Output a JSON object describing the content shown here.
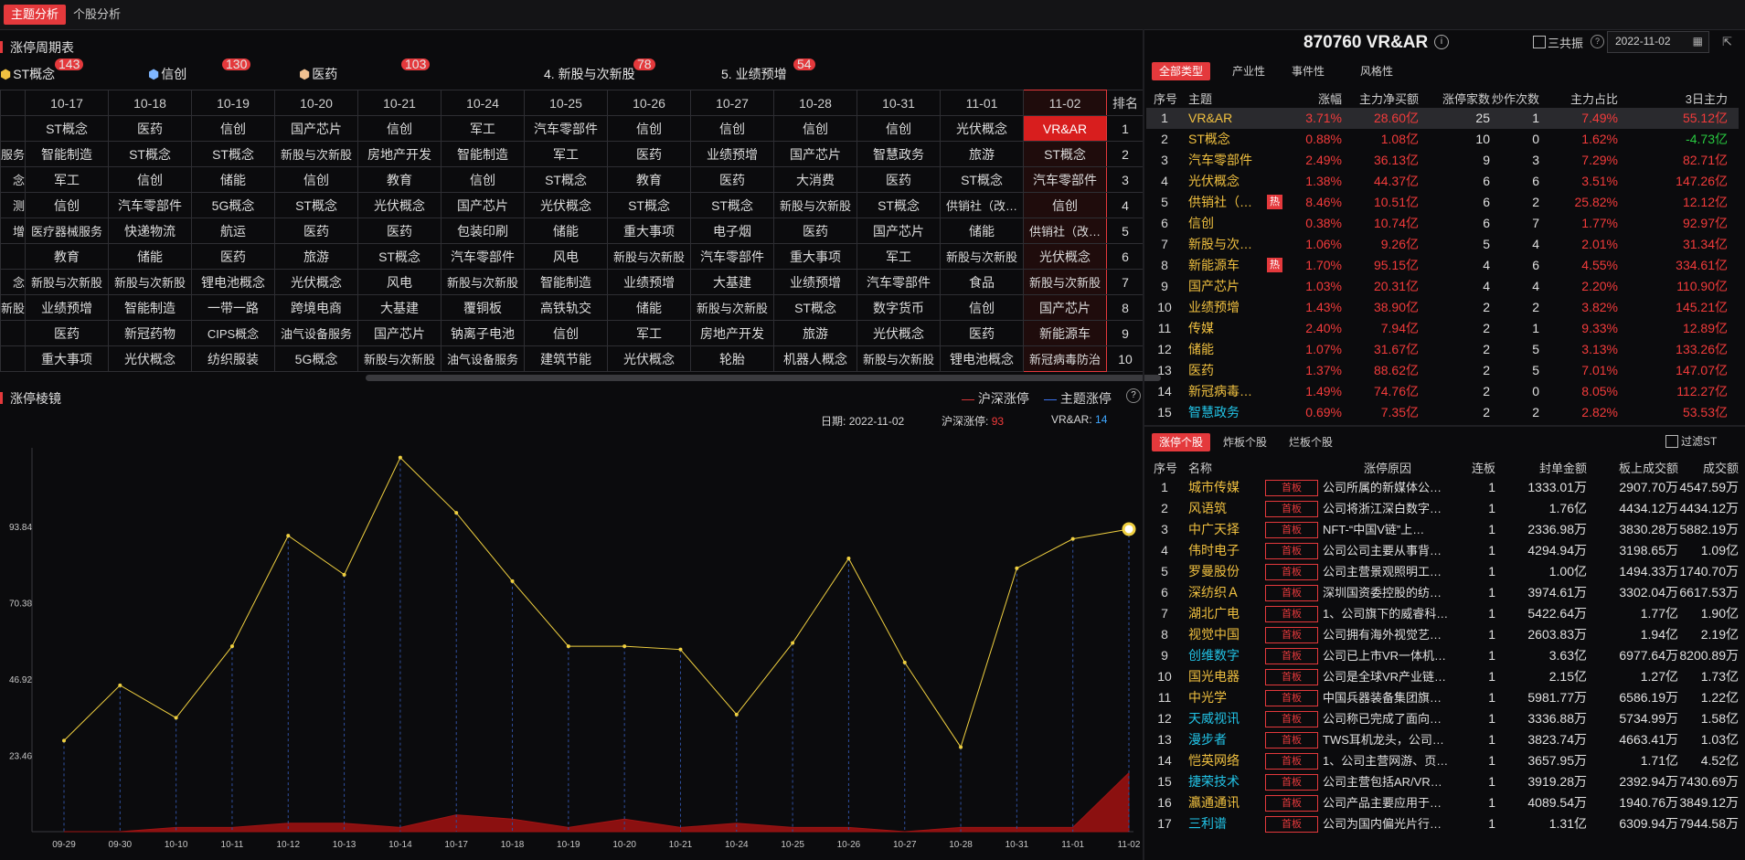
{
  "top_tabs": {
    "active": "主题分析",
    "other": "个股分析"
  },
  "cycle_panel": {
    "title": "涨停周期表",
    "tags": [
      {
        "label": "ST概念",
        "count": "143",
        "icon": "cube-icon"
      },
      {
        "label": "信创",
        "count": "130",
        "icon": "cube-icon"
      },
      {
        "label": "医药",
        "count": "103",
        "icon": "cube-icon"
      },
      {
        "label": "4. 新股与次新股",
        "count": "78"
      },
      {
        "label": "5. 业绩预增",
        "count": "54"
      }
    ],
    "dates": [
      "10-17",
      "10-18",
      "10-19",
      "10-20",
      "10-21",
      "10-24",
      "10-25",
      "10-26",
      "10-27",
      "10-28",
      "10-31",
      "11-01",
      "11-02"
    ],
    "rank_header": "排名",
    "first_col": [
      "",
      "服务",
      "念",
      "测",
      "增",
      "",
      "念",
      "新股",
      "",
      ""
    ],
    "rows": [
      [
        "ST概念",
        "医药",
        "信创",
        "国产芯片",
        "信创",
        "军工",
        "汽车零部件",
        "信创",
        "信创",
        "信创",
        "信创",
        "光伏概念",
        "VR&AR"
      ],
      [
        "智能制造",
        "ST概念",
        "ST概念",
        "新股与次新股",
        "房地产开发",
        "智能制造",
        "军工",
        "医药",
        "业绩预增",
        "国产芯片",
        "智慧政务",
        "旅游",
        "ST概念"
      ],
      [
        "军工",
        "信创",
        "储能",
        "信创",
        "教育",
        "信创",
        "ST概念",
        "教育",
        "医药",
        "大消费",
        "医药",
        "ST概念",
        "汽车零部件"
      ],
      [
        "信创",
        "汽车零部件",
        "5G概念",
        "ST概念",
        "光伏概念",
        "国产芯片",
        "光伏概念",
        "ST概念",
        "ST概念",
        "新股与次新股",
        "ST概念",
        "供销社（改…",
        "信创"
      ],
      [
        "医疗器械服务",
        "快递物流",
        "航运",
        "医药",
        "医药",
        "包装印刷",
        "储能",
        "重大事项",
        "电子烟",
        "医药",
        "国产芯片",
        "储能",
        "供销社（改…"
      ],
      [
        "教育",
        "储能",
        "医药",
        "旅游",
        "ST概念",
        "汽车零部件",
        "风电",
        "新股与次新股",
        "汽车零部件",
        "重大事项",
        "军工",
        "新股与次新股",
        "光伏概念"
      ],
      [
        "新股与次新股",
        "新股与次新股",
        "锂电池概念",
        "光伏概念",
        "风电",
        "新股与次新股",
        "智能制造",
        "业绩预增",
        "大基建",
        "业绩预增",
        "汽车零部件",
        "食品",
        "新股与次新股"
      ],
      [
        "业绩预增",
        "智能制造",
        "一带一路",
        "跨境电商",
        "大基建",
        "覆铜板",
        "高铁轨交",
        "储能",
        "新股与次新股",
        "ST概念",
        "数字货币",
        "信创",
        "国产芯片"
      ],
      [
        "医药",
        "新冠药物",
        "CIPS概念",
        "油气设备服务",
        "国产芯片",
        "钠离子电池",
        "信创",
        "军工",
        "房地产开发",
        "旅游",
        "光伏概念",
        "医药",
        "新能源车"
      ],
      [
        "重大事项",
        "光伏概念",
        "纺织服装",
        "5G概念",
        "新股与次新股",
        "油气设备服务",
        "建筑节能",
        "光伏概念",
        "轮胎",
        "机器人概念",
        "新股与次新股",
        "锂电池概念",
        "新冠病毒防治"
      ]
    ],
    "ranks": [
      "1",
      "2",
      "3",
      "4",
      "5",
      "6",
      "7",
      "8",
      "9",
      "10"
    ]
  },
  "mirror_panel": {
    "title": "涨停棱镜",
    "legend": {
      "market": "沪深涨停",
      "theme": "主题涨停"
    },
    "info": {
      "date_label": "日期:",
      "date": "2022-11-02",
      "market_label": "沪深涨停:",
      "market_value": "93",
      "theme_label": "VR&AR:",
      "theme_value": "14"
    },
    "colors": {
      "line": "#f0d040",
      "area": "#8b1010",
      "grid": "#3050a0"
    }
  },
  "chart_data": {
    "type": "line",
    "x": [
      "09-29",
      "09-30",
      "10-10",
      "10-11",
      "10-12",
      "10-13",
      "10-14",
      "10-17",
      "10-18",
      "10-19",
      "10-20",
      "10-21",
      "10-24",
      "10-25",
      "10-26",
      "10-27",
      "10-28",
      "10-31",
      "11-01",
      "11-02"
    ],
    "series": [
      {
        "name": "沪深涨停",
        "values": [
          28,
          45,
          35,
          57,
          91,
          79,
          115,
          98,
          77,
          57,
          57,
          56,
          36,
          58,
          84,
          52,
          26,
          81,
          90,
          93
        ]
      },
      {
        "name": "主题涨停",
        "values": [
          0,
          0,
          1,
          1,
          2,
          2,
          1,
          4,
          3,
          1,
          3,
          1,
          2,
          1,
          1,
          0,
          1,
          1,
          1,
          14
        ]
      }
    ],
    "yticks": [
      "23.46",
      "46.92",
      "70.38",
      "93.84"
    ],
    "ylim": [
      0,
      118
    ]
  },
  "detail": {
    "stock_title": "870760 VR&AR",
    "checkbox_label": "三共振",
    "date_value": "2022-11-02",
    "filters": [
      "全部类型",
      "产业性",
      "事件性",
      "风格性"
    ],
    "headers": [
      "序号",
      "主题",
      "涨幅",
      "主力净买额",
      "涨停家数",
      "炒作次数",
      "主力占比",
      "3日主力"
    ],
    "rows": [
      {
        "no": "1",
        "name": "VR&AR",
        "hot": "",
        "chg": "3.71%",
        "net": "28.60亿",
        "limit": "25",
        "times": "1",
        "ratio": "7.49%",
        "d3": "55.12亿",
        "d3neg": false,
        "cls": "yellow"
      },
      {
        "no": "2",
        "name": "ST概念",
        "hot": "",
        "chg": "0.88%",
        "net": "1.08亿",
        "limit": "10",
        "times": "0",
        "ratio": "1.62%",
        "d3": "-4.73亿",
        "d3neg": true,
        "cls": "yellow"
      },
      {
        "no": "3",
        "name": "汽车零部件",
        "hot": "",
        "chg": "2.49%",
        "net": "36.13亿",
        "limit": "9",
        "times": "3",
        "ratio": "7.29%",
        "d3": "82.71亿",
        "d3neg": false,
        "cls": "yellow"
      },
      {
        "no": "4",
        "name": "光伏概念",
        "hot": "",
        "chg": "1.38%",
        "net": "44.37亿",
        "limit": "6",
        "times": "6",
        "ratio": "3.51%",
        "d3": "147.26亿",
        "d3neg": false,
        "cls": "yellow"
      },
      {
        "no": "5",
        "name": "供销社（…",
        "hot": "热",
        "chg": "8.46%",
        "net": "10.51亿",
        "limit": "6",
        "times": "2",
        "ratio": "25.82%",
        "d3": "12.12亿",
        "d3neg": false,
        "cls": "yellow"
      },
      {
        "no": "6",
        "name": "信创",
        "hot": "",
        "chg": "0.38%",
        "net": "10.74亿",
        "limit": "6",
        "times": "7",
        "ratio": "1.77%",
        "d3": "92.97亿",
        "d3neg": false,
        "cls": "yellow"
      },
      {
        "no": "7",
        "name": "新股与次…",
        "hot": "",
        "chg": "1.06%",
        "net": "9.26亿",
        "limit": "5",
        "times": "4",
        "ratio": "2.01%",
        "d3": "31.34亿",
        "d3neg": false,
        "cls": "yellow"
      },
      {
        "no": "8",
        "name": "新能源车",
        "hot": "热",
        "chg": "1.70%",
        "net": "95.15亿",
        "limit": "4",
        "times": "6",
        "ratio": "4.55%",
        "d3": "334.61亿",
        "d3neg": false,
        "cls": "yellow"
      },
      {
        "no": "9",
        "name": "国产芯片",
        "hot": "",
        "chg": "1.03%",
        "net": "20.31亿",
        "limit": "4",
        "times": "4",
        "ratio": "2.20%",
        "d3": "110.90亿",
        "d3neg": false,
        "cls": "yellow"
      },
      {
        "no": "10",
        "name": "业绩预增",
        "hot": "",
        "chg": "1.43%",
        "net": "38.90亿",
        "limit": "2",
        "times": "2",
        "ratio": "3.82%",
        "d3": "145.21亿",
        "d3neg": false,
        "cls": "yellow"
      },
      {
        "no": "11",
        "name": "传媒",
        "hot": "",
        "chg": "2.40%",
        "net": "7.94亿",
        "limit": "2",
        "times": "1",
        "ratio": "9.33%",
        "d3": "12.89亿",
        "d3neg": false,
        "cls": "yellow"
      },
      {
        "no": "12",
        "name": "储能",
        "hot": "",
        "chg": "1.07%",
        "net": "31.67亿",
        "limit": "2",
        "times": "5",
        "ratio": "3.13%",
        "d3": "133.26亿",
        "d3neg": false,
        "cls": "yellow"
      },
      {
        "no": "13",
        "name": "医药",
        "hot": "",
        "chg": "1.37%",
        "net": "88.62亿",
        "limit": "2",
        "times": "5",
        "ratio": "7.01%",
        "d3": "147.07亿",
        "d3neg": false,
        "cls": "yellow"
      },
      {
        "no": "14",
        "name": "新冠病毒…",
        "hot": "",
        "chg": "1.49%",
        "net": "74.76亿",
        "limit": "2",
        "times": "0",
        "ratio": "8.05%",
        "d3": "112.27亿",
        "d3neg": false,
        "cls": "yellow"
      },
      {
        "no": "15",
        "name": "智慧政务",
        "hot": "",
        "chg": "0.69%",
        "net": "7.35亿",
        "limit": "2",
        "times": "2",
        "ratio": "2.82%",
        "d3": "53.53亿",
        "d3neg": false,
        "cls": "cyan"
      }
    ]
  },
  "stocks": {
    "tabs": [
      "涨停个股",
      "炸板个股",
      "烂板个股"
    ],
    "filter_st": "过滤ST",
    "headers": [
      "序号",
      "名称",
      "涨停原因",
      "连板",
      "封单金额",
      "板上成交额",
      "成交额"
    ],
    "board_label": "首板",
    "rows": [
      {
        "no": "1",
        "name": "城市传媒",
        "reason": "公司所属的新媒体公…",
        "lian": "1",
        "seal": "1333.01万",
        "board": "2907.70万",
        "amt": "4547.59万",
        "cls": "yellow"
      },
      {
        "no": "2",
        "name": "风语筑",
        "reason": "公司将浙江深白数字…",
        "lian": "1",
        "seal": "1.76亿",
        "board": "4434.12万",
        "amt": "4434.12万",
        "cls": "yellow"
      },
      {
        "no": "3",
        "name": "中广天择",
        "reason": "NFT-“中国V链”上…",
        "lian": "1",
        "seal": "2336.98万",
        "board": "3830.28万",
        "amt": "5882.19万",
        "cls": "yellow"
      },
      {
        "no": "4",
        "name": "伟时电子",
        "reason": "公司公司主要从事背…",
        "lian": "1",
        "seal": "4294.94万",
        "board": "3198.65万",
        "amt": "1.09亿",
        "cls": "yellow"
      },
      {
        "no": "5",
        "name": "罗曼股份",
        "reason": "公司主营景观照明工…",
        "lian": "1",
        "seal": "1.00亿",
        "board": "1494.33万",
        "amt": "1740.70万",
        "cls": "yellow"
      },
      {
        "no": "6",
        "name": "深纺织Ａ",
        "reason": "深圳国资委控股的纺…",
        "lian": "1",
        "seal": "3974.61万",
        "board": "3302.04万",
        "amt": "6617.53万",
        "cls": "yellow"
      },
      {
        "no": "7",
        "name": "湖北广电",
        "reason": "1、公司旗下的威睿科…",
        "lian": "1",
        "seal": "5422.64万",
        "board": "1.77亿",
        "amt": "1.90亿",
        "cls": "yellow"
      },
      {
        "no": "8",
        "name": "视觉中国",
        "reason": "公司拥有海外视觉艺…",
        "lian": "1",
        "seal": "2603.83万",
        "board": "1.94亿",
        "amt": "2.19亿",
        "cls": "yellow"
      },
      {
        "no": "9",
        "name": "创维数字",
        "reason": "公司已上市VR一体机…",
        "lian": "1",
        "seal": "3.63亿",
        "board": "6977.64万",
        "amt": "8200.89万",
        "cls": "cyan"
      },
      {
        "no": "10",
        "name": "国光电器",
        "reason": "公司是全球VR产业链…",
        "lian": "1",
        "seal": "2.15亿",
        "board": "1.27亿",
        "amt": "1.73亿",
        "cls": "yellow"
      },
      {
        "no": "11",
        "name": "中光学",
        "reason": "中国兵器装备集团旗…",
        "lian": "1",
        "seal": "5981.77万",
        "board": "6586.19万",
        "amt": "1.22亿",
        "cls": "yellow"
      },
      {
        "no": "12",
        "name": "天威视讯",
        "reason": "公司称已完成了面向…",
        "lian": "1",
        "seal": "3336.88万",
        "board": "5734.99万",
        "amt": "1.58亿",
        "cls": "cyan"
      },
      {
        "no": "13",
        "name": "漫步者",
        "reason": "TWS耳机龙头，公司…",
        "lian": "1",
        "seal": "3823.74万",
        "board": "4663.41万",
        "amt": "1.03亿",
        "cls": "cyan"
      },
      {
        "no": "14",
        "name": "恺英网络",
        "reason": "1、公司主营网游、页…",
        "lian": "1",
        "seal": "3657.95万",
        "board": "1.71亿",
        "amt": "4.52亿",
        "cls": "yellow"
      },
      {
        "no": "15",
        "name": "捷荣技术",
        "reason": "公司主营包括AR/VR…",
        "lian": "1",
        "seal": "3919.28万",
        "board": "2392.94万",
        "amt": "7430.69万",
        "cls": "cyan"
      },
      {
        "no": "16",
        "name": "瀛通通讯",
        "reason": "公司产品主要应用于…",
        "lian": "1",
        "seal": "4089.54万",
        "board": "1940.76万",
        "amt": "3849.12万",
        "cls": "yellow"
      },
      {
        "no": "17",
        "name": "三利谱",
        "reason": "公司为国内偏光片行…",
        "lian": "1",
        "seal": "1.31亿",
        "board": "6309.94万",
        "amt": "7944.58万",
        "cls": "cyan"
      }
    ]
  }
}
